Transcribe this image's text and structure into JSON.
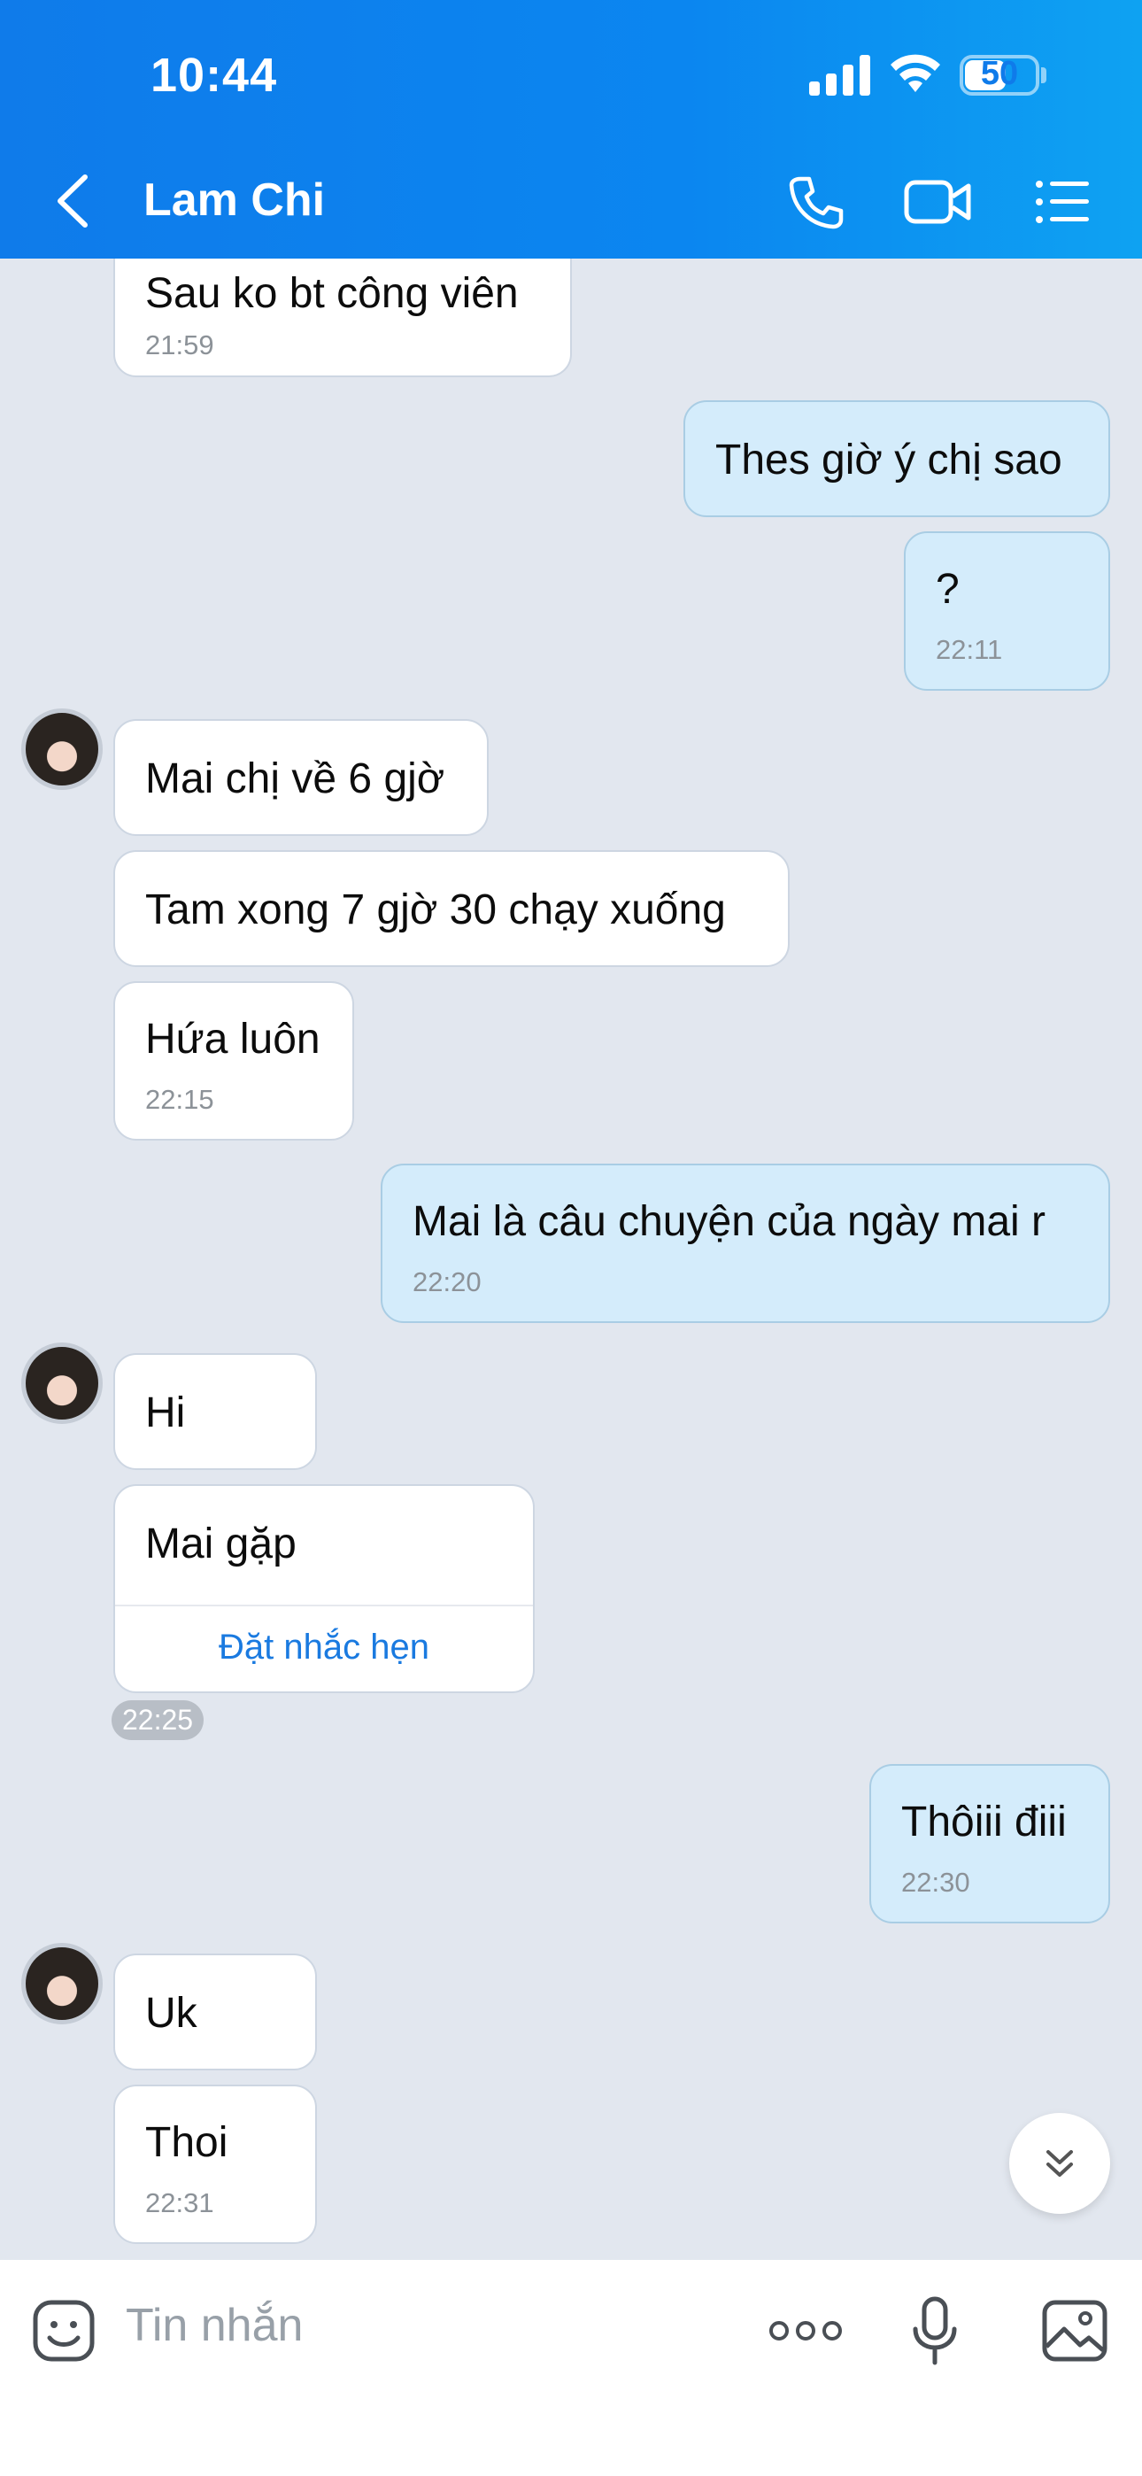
{
  "status_bar": {
    "time": "10:44",
    "battery": "50"
  },
  "header": {
    "contact_name": "Lam Chi"
  },
  "messages": [
    {
      "text": "Sau ko bt công viên",
      "time": "21:59"
    },
    {
      "text": "Thes giờ ý chị sao"
    },
    {
      "text": "?",
      "time": "22:11"
    },
    {
      "text": "Mai chị về 6 gjờ"
    },
    {
      "text": "Tam xong 7 gjờ 30 chạy xuống"
    },
    {
      "text": "Hứa luôn",
      "time": "22:15"
    },
    {
      "text": "Mai là câu chuyện của ngày mai r",
      "time": "22:20"
    },
    {
      "text": "Hi"
    },
    {
      "text": "Mai gặp",
      "action": "Đặt nhắc hẹn"
    },
    {
      "time": "22:25"
    },
    {
      "text": "Thôiii điii",
      "time": "22:30"
    },
    {
      "text": "Uk"
    },
    {
      "text": "Thoi",
      "time": "22:31"
    }
  ],
  "input": {
    "placeholder": "Tin nhắn"
  },
  "colors": {
    "header_blue": "#0f7bea",
    "outgoing_bubble": "#d4ecfb",
    "chat_bg": "#e2e7ef",
    "link": "#1a7ae0"
  }
}
